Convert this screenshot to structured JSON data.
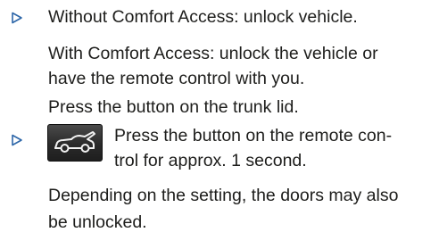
{
  "items": [
    {
      "bullet_icon": "triangle-bullet-icon",
      "lines": [
        "Without Comfort Access: unlock vehicle.",
        "With Comfort Access: unlock the vehicle or",
        "have the remote control with you.",
        "Press the button on the trunk lid."
      ]
    },
    {
      "bullet_icon": "triangle-bullet-icon",
      "key_icon": "trunk-open-key-icon",
      "lines": [
        "Press the button on the remote con-",
        "trol for approx. 1 second.",
        "Depending on the setting, the doors may also",
        "be unlocked."
      ]
    }
  ]
}
